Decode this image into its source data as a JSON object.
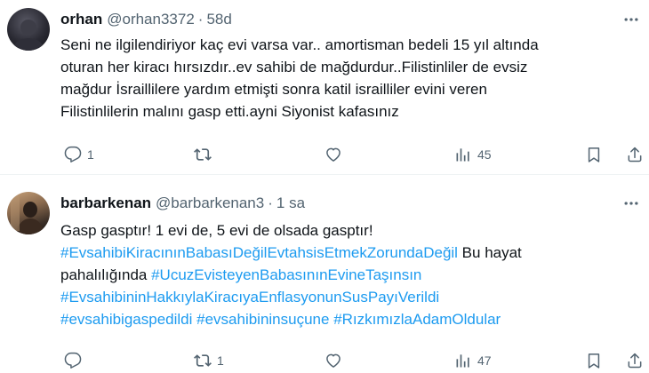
{
  "tweets": [
    {
      "name": "orhan",
      "handle": "@orhan3372",
      "time": "58d",
      "lines": [
        "Seni ne ilgilendiriyor kaç evi varsa var.. amortisman bedeli 15 yıl altında",
        "oturan her kiracı hırsızdır..ev sahibi de mağdurdur..Filistinliler de evsiz",
        "mağdur İsraillilere yardım etmişti sonra katil israilliler evini veren",
        "Filistinlilerin malını gasp etti.ayni Siyonist kafasınız"
      ],
      "replies": "1",
      "retweets": "",
      "likes": "",
      "views": "45"
    },
    {
      "name": "barbarkenan",
      "handle": "@barbarkenan3",
      "time": "1 sa",
      "line1": "Gasp gasptır! 1 evi de, 5 evi de olsada gasptır!",
      "hashtag1": "#EvsahibiKiracınınBabasıDeğilEvtahsisEtmekZorundaDeğil",
      "line2_tail": " Bu hayat",
      "line3_head": "pahalılığında ",
      "hashtag2": "#UcuzEvisteyenBabasınınEvineTaşınsın",
      "hashtag3": "#EvsahibininHakkıylaKiracıyaEnflasyonunSusPayıVerildi",
      "hashtag4": "#evsahibigaspedildi",
      "hashtag5": "#evsahibininsuçune",
      "hashtag6": "#RızkımızlaAdamOldular",
      "replies": "",
      "retweets": "1",
      "likes": "",
      "views": "47"
    }
  ],
  "icons": {
    "more": "more-horizontal-icon",
    "reply": "reply-icon",
    "retweet": "retweet-icon",
    "like": "heart-icon",
    "views": "views-icon",
    "bookmark": "bookmark-icon",
    "share": "share-icon"
  },
  "colors": {
    "text": "#0f1419",
    "muted": "#536471",
    "link": "#1d9bf0",
    "divider": "#eff3f4"
  }
}
